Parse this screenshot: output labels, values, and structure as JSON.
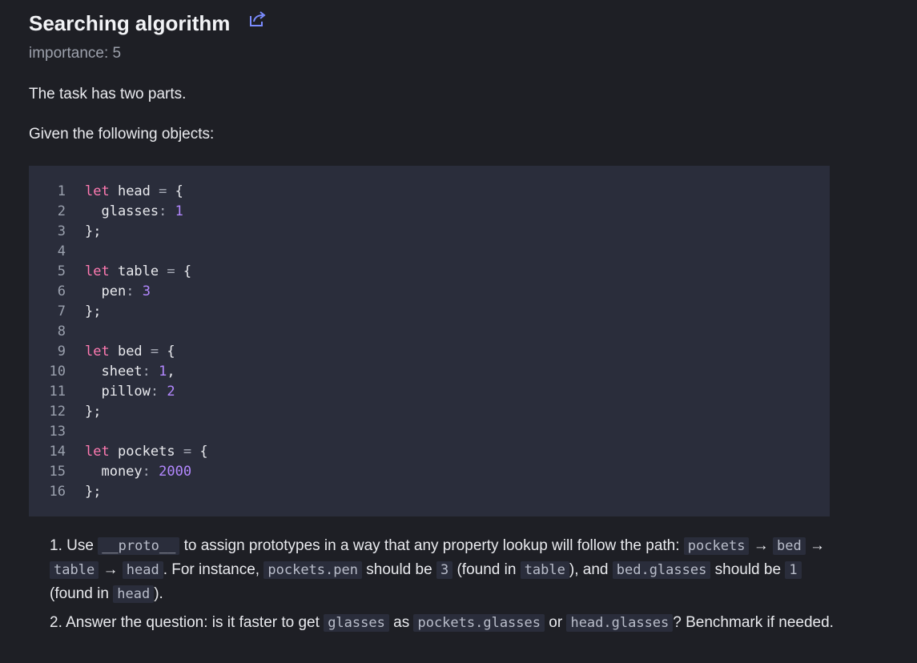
{
  "title": "Searching algorithm",
  "importance": "importance: 5",
  "intro": "The task has two parts.",
  "given": "Given the following objects:",
  "code": [
    {
      "n": "1",
      "parts": [
        [
          "kw",
          "let"
        ],
        [
          "t",
          " head "
        ],
        [
          "punc",
          "="
        ],
        [
          "t",
          " {"
        ]
      ]
    },
    {
      "n": "2",
      "parts": [
        [
          "t",
          "  glasses"
        ],
        [
          "punc",
          ":"
        ],
        [
          "t",
          " "
        ],
        [
          "num",
          "1"
        ]
      ]
    },
    {
      "n": "3",
      "parts": [
        [
          "t",
          "};"
        ]
      ]
    },
    {
      "n": "4",
      "parts": []
    },
    {
      "n": "5",
      "parts": [
        [
          "kw",
          "let"
        ],
        [
          "t",
          " table "
        ],
        [
          "punc",
          "="
        ],
        [
          "t",
          " {"
        ]
      ]
    },
    {
      "n": "6",
      "parts": [
        [
          "t",
          "  pen"
        ],
        [
          "punc",
          ":"
        ],
        [
          "t",
          " "
        ],
        [
          "num",
          "3"
        ]
      ]
    },
    {
      "n": "7",
      "parts": [
        [
          "t",
          "};"
        ]
      ]
    },
    {
      "n": "8",
      "parts": []
    },
    {
      "n": "9",
      "parts": [
        [
          "kw",
          "let"
        ],
        [
          "t",
          " bed "
        ],
        [
          "punc",
          "="
        ],
        [
          "t",
          " {"
        ]
      ]
    },
    {
      "n": "10",
      "parts": [
        [
          "t",
          "  sheet"
        ],
        [
          "punc",
          ":"
        ],
        [
          "t",
          " "
        ],
        [
          "num",
          "1"
        ],
        [
          "t",
          ","
        ]
      ]
    },
    {
      "n": "11",
      "parts": [
        [
          "t",
          "  pillow"
        ],
        [
          "punc",
          ":"
        ],
        [
          "t",
          " "
        ],
        [
          "num",
          "2"
        ]
      ]
    },
    {
      "n": "12",
      "parts": [
        [
          "t",
          "};"
        ]
      ]
    },
    {
      "n": "13",
      "parts": []
    },
    {
      "n": "14",
      "parts": [
        [
          "kw",
          "let"
        ],
        [
          "t",
          " pockets "
        ],
        [
          "punc",
          "="
        ],
        [
          "t",
          " {"
        ]
      ]
    },
    {
      "n": "15",
      "parts": [
        [
          "t",
          "  money"
        ],
        [
          "punc",
          ":"
        ],
        [
          "t",
          " "
        ],
        [
          "num",
          "2000"
        ]
      ]
    },
    {
      "n": "16",
      "parts": [
        [
          "t",
          "};"
        ]
      ]
    }
  ],
  "tasks": [
    {
      "label": "task-1",
      "parts": [
        [
          "t",
          "1. Use "
        ],
        [
          "c",
          "__proto__"
        ],
        [
          "t",
          " to assign prototypes in a way that any property lookup will follow the path: "
        ],
        [
          "c",
          "pockets"
        ],
        [
          "t",
          " → "
        ],
        [
          "c",
          "bed"
        ],
        [
          "t",
          " → "
        ],
        [
          "c",
          "table"
        ],
        [
          "t",
          " → "
        ],
        [
          "c",
          "head"
        ],
        [
          "t",
          ". For instance, "
        ],
        [
          "c",
          "pockets.pen"
        ],
        [
          "t",
          " should be "
        ],
        [
          "c",
          "3"
        ],
        [
          "t",
          " (found in "
        ],
        [
          "c",
          "table"
        ],
        [
          "t",
          "), and "
        ],
        [
          "c",
          "bed.glasses"
        ],
        [
          "t",
          " should be "
        ],
        [
          "c",
          "1"
        ],
        [
          "t",
          " (found in "
        ],
        [
          "c",
          "head"
        ],
        [
          "t",
          ")."
        ]
      ]
    },
    {
      "label": "task-2",
      "parts": [
        [
          "t",
          "2. Answer the question: is it faster to get "
        ],
        [
          "c",
          "glasses"
        ],
        [
          "t",
          " as "
        ],
        [
          "c",
          "pockets.glasses"
        ],
        [
          "t",
          " or "
        ],
        [
          "c",
          "head.glasses"
        ],
        [
          "t",
          "? Benchmark if needed."
        ]
      ]
    }
  ]
}
